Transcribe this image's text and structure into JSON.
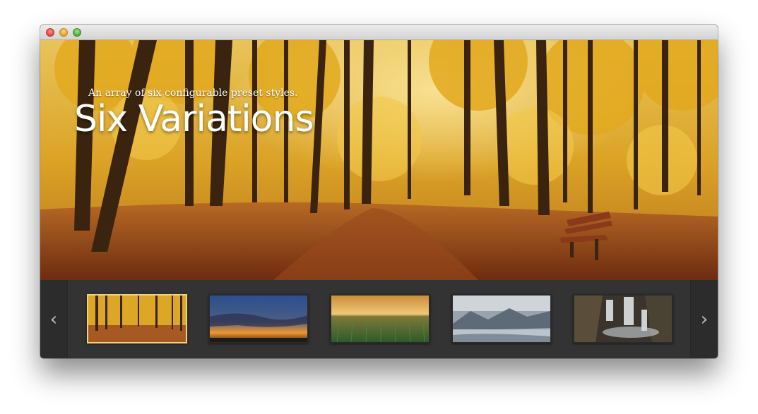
{
  "window": {
    "traffic_lights": [
      "close",
      "minimize",
      "zoom"
    ]
  },
  "slide": {
    "subtitle": "An array of six configurable preset styles.",
    "title": "Six Variations",
    "image": "autumn-forest-with-bench"
  },
  "thumbnails": [
    {
      "image": "autumn-forest",
      "active": true
    },
    {
      "image": "sunset-sky",
      "active": false
    },
    {
      "image": "green-field-dusk",
      "active": false
    },
    {
      "image": "mountain-lake",
      "active": false
    },
    {
      "image": "waterfall",
      "active": false
    }
  ],
  "navigation": {
    "prev_icon": "‹",
    "next_icon": "›"
  },
  "colors": {
    "active_thumb_border": "#f0d67a",
    "strip_background": "#333333"
  }
}
